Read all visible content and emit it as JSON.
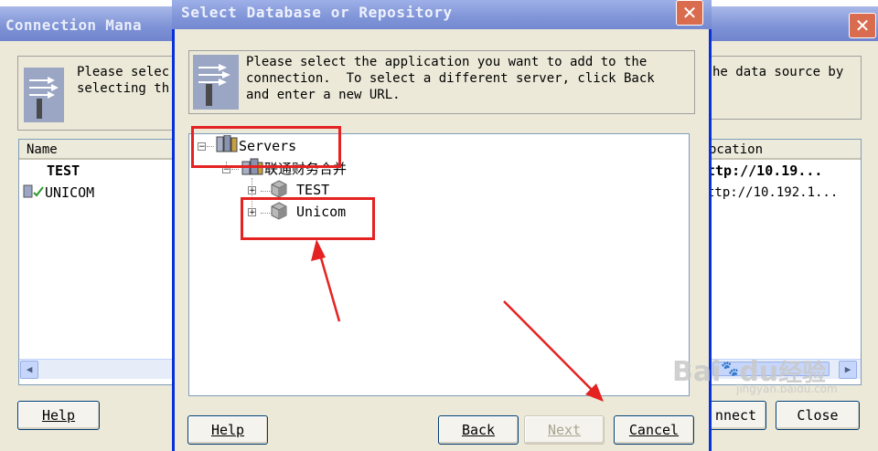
{
  "connection_manager": {
    "title": "Connection Mana",
    "info_left": "Please selec\nselecting th",
    "info_right": "he data source by",
    "column_name": "Name",
    "column_location": "ocation",
    "rows": [
      {
        "name": "TEST",
        "location": "ttp://10.19..."
      },
      {
        "name": "UNICOM",
        "location": "ttp://10.192.1..."
      }
    ],
    "help_label": "Help",
    "connect_label": "nnect",
    "close_label": "Close"
  },
  "dialog": {
    "title": "Select Database or Repository",
    "info": "Please select the application you want to add to the\nconnection.  To select a different server, click Back\nand enter a new URL.",
    "tree": {
      "root": "Servers",
      "group": "联通财务合并",
      "items": [
        "TEST",
        "Unicom"
      ]
    },
    "buttons": {
      "help": "Help",
      "back": "Back",
      "next": "Next",
      "cancel": "Cancel"
    }
  },
  "watermark": {
    "brand": "Bai",
    "paw": "du",
    "cn": "经验",
    "url": "jingyan.baidu.com"
  },
  "colors": {
    "annotation": "#e52222",
    "title_bar": "#8095d8",
    "dialog_face": "#ece9d8"
  }
}
